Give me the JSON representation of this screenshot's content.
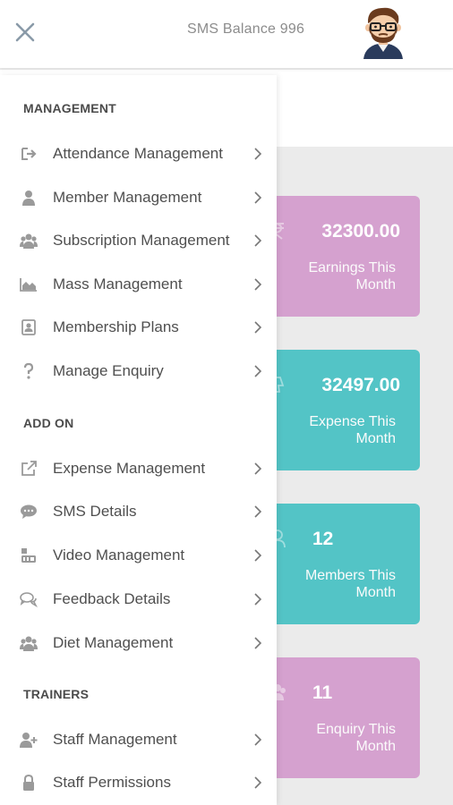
{
  "header": {
    "sms_balance": "SMS Balance 996"
  },
  "dashboard": {
    "cards": [
      {
        "value": "32300.00",
        "label": "Earnings This Month",
        "color": "#d5a1cf"
      },
      {
        "value": "32497.00",
        "label": "Expense This Month",
        "color": "#53c4c6"
      },
      {
        "value": "12",
        "label": "Members This Month",
        "color": "#53c4c6"
      },
      {
        "value": "11",
        "label": "Enquiry This Month",
        "color": "#d5a1cf"
      }
    ]
  },
  "drawer": {
    "sections": {
      "management": "MANAGEMENT",
      "add_on": "ADD ON",
      "trainers": "TRAINERS"
    },
    "items": [
      {
        "label": "Attendance Management",
        "icon": "sign-in-icon"
      },
      {
        "label": "Member Management",
        "icon": "user-icon"
      },
      {
        "label": "Subscription Management",
        "icon": "users-icon"
      },
      {
        "label": "Mass Management",
        "icon": "area-chart-icon"
      },
      {
        "label": "Membership Plans",
        "icon": "id-card-icon"
      },
      {
        "label": "Manage Enquiry",
        "icon": "question-icon"
      },
      {
        "label": "Expense Management",
        "icon": "external-link-icon"
      },
      {
        "label": "SMS Details",
        "icon": "comment-icon"
      },
      {
        "label": "Video Management",
        "icon": "youtube-icon"
      },
      {
        "label": "Feedback Details",
        "icon": "comments-icon"
      },
      {
        "label": "Diet Management",
        "icon": "users-icon"
      },
      {
        "label": "Staff Management",
        "icon": "user-plus-icon"
      },
      {
        "label": "Staff Permissions",
        "icon": "lock-icon"
      }
    ]
  },
  "colors": {
    "pink_card": "#d5a1cf",
    "teal_card": "#53c4c6",
    "icon_gray": "#9a9a9a",
    "text_dark": "#4f4f4f"
  }
}
